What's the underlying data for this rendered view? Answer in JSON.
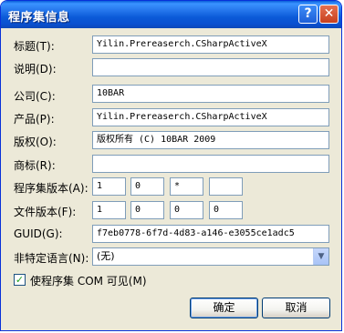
{
  "window": {
    "title": "程序集信息",
    "help_glyph": "?",
    "close_glyph": "✕"
  },
  "fields": {
    "title": {
      "label": "标题(T):",
      "value": "Yilin.Prereaserch.CSharpActiveX"
    },
    "description": {
      "label": "说明(D):",
      "value": ""
    },
    "company": {
      "label": "公司(C):",
      "value": "10BAR"
    },
    "product": {
      "label": "产品(P):",
      "value": "Yilin.Prereaserch.CSharpActiveX"
    },
    "copyright": {
      "label": "版权(O):",
      "value": "版权所有 (C) 10BAR 2009"
    },
    "trademark": {
      "label": "商标(R):",
      "value": ""
    },
    "assembly_version": {
      "label": "程序集版本(A):",
      "parts": [
        "1",
        "0",
        "*",
        ""
      ]
    },
    "file_version": {
      "label": "文件版本(F):",
      "parts": [
        "1",
        "0",
        "0",
        "0"
      ]
    },
    "guid": {
      "label": "GUID(G):",
      "value": "f7eb0778-6f7d-4d83-a146-e3055ce1adc5"
    },
    "neutral_language": {
      "label": "非特定语言(N):",
      "value": "(无)"
    }
  },
  "com_visible": {
    "checked": true,
    "check_glyph": "✓",
    "label": "使程序集 COM 可见(M)"
  },
  "buttons": {
    "ok": "确定",
    "cancel": "取消"
  },
  "icons": {
    "dropdown": "chevron-down-icon",
    "help": "help-icon",
    "close": "close-icon",
    "check": "checkmark-icon"
  }
}
